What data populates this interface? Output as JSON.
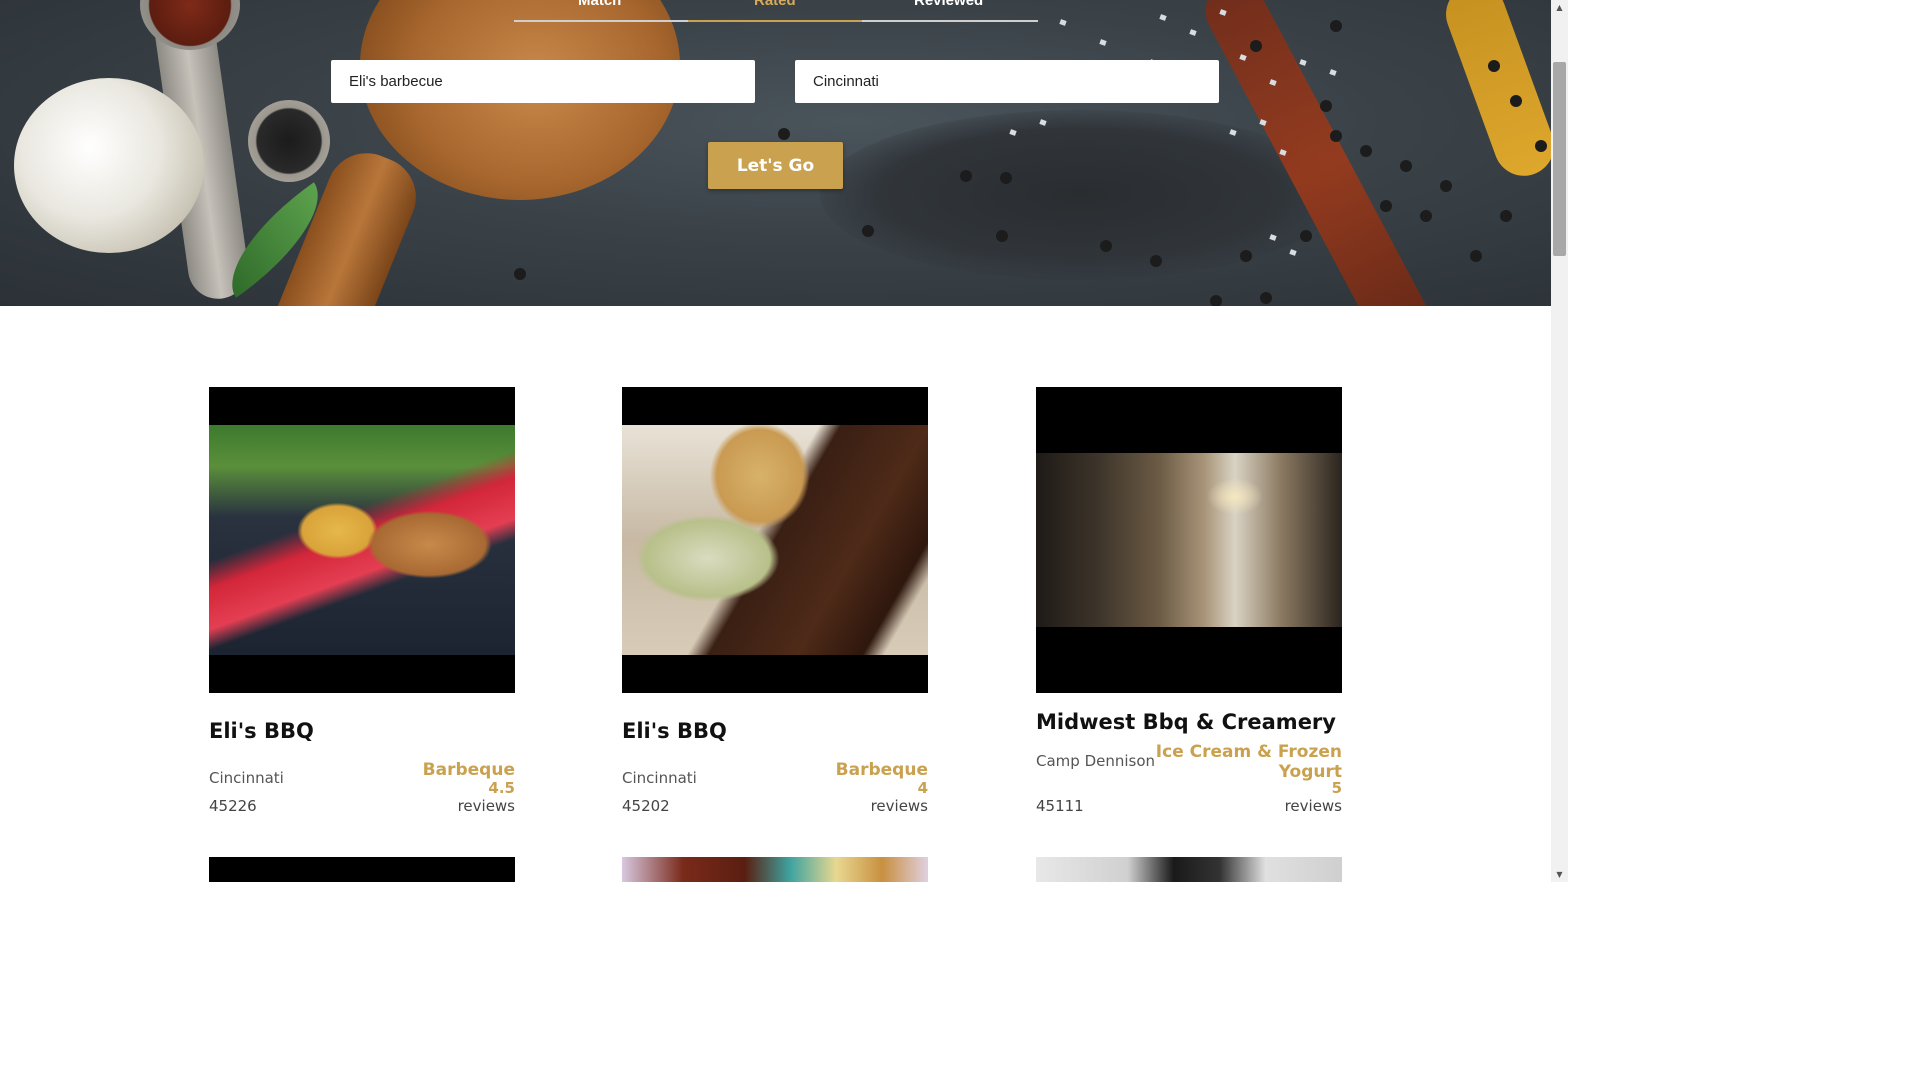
{
  "tabs": [
    {
      "label": "Match",
      "active": false
    },
    {
      "label": "Rated",
      "active": true
    },
    {
      "label": "Reviewed",
      "active": false
    }
  ],
  "search": {
    "term_value": "Eli's barbecue",
    "location_value": "Cincinnati",
    "submit_label": "Let's Go"
  },
  "results": [
    {
      "name": "Eli's BBQ",
      "city": "Cincinnati",
      "zip": "45226",
      "category": "Barbeque",
      "review_count": "4.5",
      "reviews_label": "reviews"
    },
    {
      "name": "Eli's BBQ",
      "city": "Cincinnati",
      "zip": "45202",
      "category": "Barbeque",
      "review_count": "4",
      "reviews_label": "reviews"
    },
    {
      "name": "Midwest Bbq & Creamery",
      "city": "Camp Dennison",
      "zip": "45111",
      "category": "Ice Cream & Frozen Yogurt",
      "review_count": "5",
      "reviews_label": "reviews"
    }
  ],
  "colors": {
    "accent": "#c9a14f",
    "heading": "#111111",
    "muted": "#555555"
  }
}
